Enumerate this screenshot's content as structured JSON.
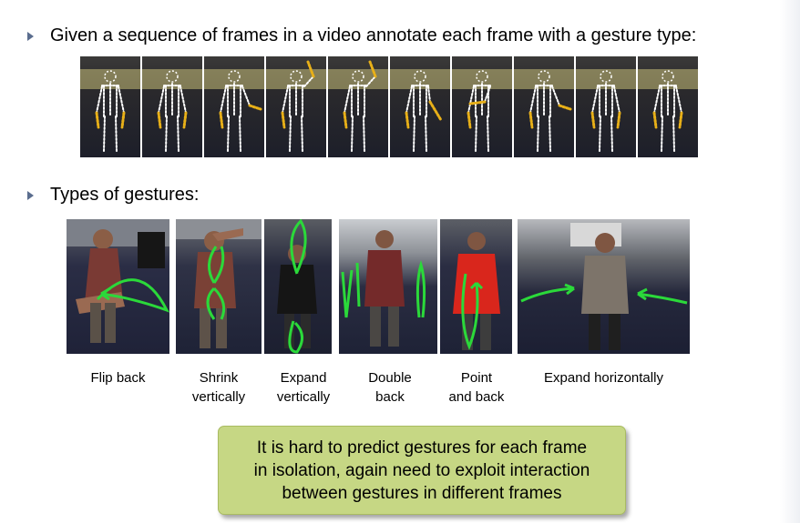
{
  "bullets": [
    {
      "text": "Given a sequence of frames in a video annotate each frame with a gesture type:"
    },
    {
      "text": "Types of gestures:"
    }
  ],
  "icons": {
    "bullet": "triangle-bullet-icon"
  },
  "colors": {
    "bullet": "#5a6d8e",
    "callout_bg": "#c6d784",
    "arrow": "#2bd93a",
    "skeleton": "#ffffff",
    "limb_highlight": "#e8b018"
  },
  "frame_poses": [
    "rest",
    "rest",
    "arm-out",
    "arm-up",
    "arm-up",
    "arm-down",
    "arm-cross",
    "arm-out",
    "rest",
    "rest"
  ],
  "gestures": [
    {
      "caption": "Flip back"
    },
    {
      "caption": "Shrink\nvertically"
    },
    {
      "caption": "Expand\nvertically"
    },
    {
      "caption": "Double\nback"
    },
    {
      "caption": "Point\nand back"
    },
    {
      "caption": "Expand horizontally"
    }
  ],
  "callout": {
    "text": "It is hard to predict gestures for each frame\nin isolation, again need to exploit interaction\nbetween gestures in different frames"
  }
}
